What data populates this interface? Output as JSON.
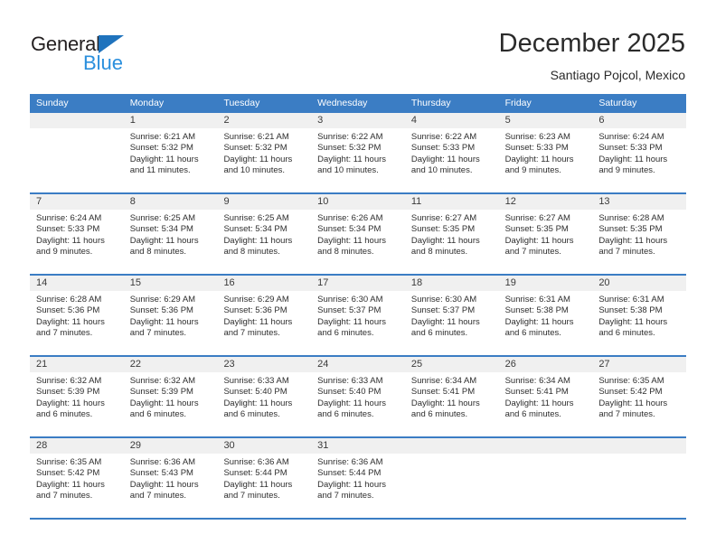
{
  "brand": {
    "name_part1": "General",
    "name_part2": "Blue",
    "triangle_icon": "triangle-icon",
    "primary_color": "#2a8fdd",
    "dark_color": "#231f20"
  },
  "header": {
    "title": "December 2025",
    "subtitle": "Santiago Pojcol, Mexico"
  },
  "calendar": {
    "header_color": "#3b7dc4",
    "weekdays": [
      "Sunday",
      "Monday",
      "Tuesday",
      "Wednesday",
      "Thursday",
      "Friday",
      "Saturday"
    ],
    "weeks": [
      [
        {
          "day": "",
          "sunrise": "",
          "sunset": "",
          "daylight_line1": "",
          "daylight_line2": ""
        },
        {
          "day": "1",
          "sunrise": "Sunrise: 6:21 AM",
          "sunset": "Sunset: 5:32 PM",
          "daylight_line1": "Daylight: 11 hours",
          "daylight_line2": "and 11 minutes."
        },
        {
          "day": "2",
          "sunrise": "Sunrise: 6:21 AM",
          "sunset": "Sunset: 5:32 PM",
          "daylight_line1": "Daylight: 11 hours",
          "daylight_line2": "and 10 minutes."
        },
        {
          "day": "3",
          "sunrise": "Sunrise: 6:22 AM",
          "sunset": "Sunset: 5:32 PM",
          "daylight_line1": "Daylight: 11 hours",
          "daylight_line2": "and 10 minutes."
        },
        {
          "day": "4",
          "sunrise": "Sunrise: 6:22 AM",
          "sunset": "Sunset: 5:33 PM",
          "daylight_line1": "Daylight: 11 hours",
          "daylight_line2": "and 10 minutes."
        },
        {
          "day": "5",
          "sunrise": "Sunrise: 6:23 AM",
          "sunset": "Sunset: 5:33 PM",
          "daylight_line1": "Daylight: 11 hours",
          "daylight_line2": "and 9 minutes."
        },
        {
          "day": "6",
          "sunrise": "Sunrise: 6:24 AM",
          "sunset": "Sunset: 5:33 PM",
          "daylight_line1": "Daylight: 11 hours",
          "daylight_line2": "and 9 minutes."
        }
      ],
      [
        {
          "day": "7",
          "sunrise": "Sunrise: 6:24 AM",
          "sunset": "Sunset: 5:33 PM",
          "daylight_line1": "Daylight: 11 hours",
          "daylight_line2": "and 9 minutes."
        },
        {
          "day": "8",
          "sunrise": "Sunrise: 6:25 AM",
          "sunset": "Sunset: 5:34 PM",
          "daylight_line1": "Daylight: 11 hours",
          "daylight_line2": "and 8 minutes."
        },
        {
          "day": "9",
          "sunrise": "Sunrise: 6:25 AM",
          "sunset": "Sunset: 5:34 PM",
          "daylight_line1": "Daylight: 11 hours",
          "daylight_line2": "and 8 minutes."
        },
        {
          "day": "10",
          "sunrise": "Sunrise: 6:26 AM",
          "sunset": "Sunset: 5:34 PM",
          "daylight_line1": "Daylight: 11 hours",
          "daylight_line2": "and 8 minutes."
        },
        {
          "day": "11",
          "sunrise": "Sunrise: 6:27 AM",
          "sunset": "Sunset: 5:35 PM",
          "daylight_line1": "Daylight: 11 hours",
          "daylight_line2": "and 8 minutes."
        },
        {
          "day": "12",
          "sunrise": "Sunrise: 6:27 AM",
          "sunset": "Sunset: 5:35 PM",
          "daylight_line1": "Daylight: 11 hours",
          "daylight_line2": "and 7 minutes."
        },
        {
          "day": "13",
          "sunrise": "Sunrise: 6:28 AM",
          "sunset": "Sunset: 5:35 PM",
          "daylight_line1": "Daylight: 11 hours",
          "daylight_line2": "and 7 minutes."
        }
      ],
      [
        {
          "day": "14",
          "sunrise": "Sunrise: 6:28 AM",
          "sunset": "Sunset: 5:36 PM",
          "daylight_line1": "Daylight: 11 hours",
          "daylight_line2": "and 7 minutes."
        },
        {
          "day": "15",
          "sunrise": "Sunrise: 6:29 AM",
          "sunset": "Sunset: 5:36 PM",
          "daylight_line1": "Daylight: 11 hours",
          "daylight_line2": "and 7 minutes."
        },
        {
          "day": "16",
          "sunrise": "Sunrise: 6:29 AM",
          "sunset": "Sunset: 5:36 PM",
          "daylight_line1": "Daylight: 11 hours",
          "daylight_line2": "and 7 minutes."
        },
        {
          "day": "17",
          "sunrise": "Sunrise: 6:30 AM",
          "sunset": "Sunset: 5:37 PM",
          "daylight_line1": "Daylight: 11 hours",
          "daylight_line2": "and 6 minutes."
        },
        {
          "day": "18",
          "sunrise": "Sunrise: 6:30 AM",
          "sunset": "Sunset: 5:37 PM",
          "daylight_line1": "Daylight: 11 hours",
          "daylight_line2": "and 6 minutes."
        },
        {
          "day": "19",
          "sunrise": "Sunrise: 6:31 AM",
          "sunset": "Sunset: 5:38 PM",
          "daylight_line1": "Daylight: 11 hours",
          "daylight_line2": "and 6 minutes."
        },
        {
          "day": "20",
          "sunrise": "Sunrise: 6:31 AM",
          "sunset": "Sunset: 5:38 PM",
          "daylight_line1": "Daylight: 11 hours",
          "daylight_line2": "and 6 minutes."
        }
      ],
      [
        {
          "day": "21",
          "sunrise": "Sunrise: 6:32 AM",
          "sunset": "Sunset: 5:39 PM",
          "daylight_line1": "Daylight: 11 hours",
          "daylight_line2": "and 6 minutes."
        },
        {
          "day": "22",
          "sunrise": "Sunrise: 6:32 AM",
          "sunset": "Sunset: 5:39 PM",
          "daylight_line1": "Daylight: 11 hours",
          "daylight_line2": "and 6 minutes."
        },
        {
          "day": "23",
          "sunrise": "Sunrise: 6:33 AM",
          "sunset": "Sunset: 5:40 PM",
          "daylight_line1": "Daylight: 11 hours",
          "daylight_line2": "and 6 minutes."
        },
        {
          "day": "24",
          "sunrise": "Sunrise: 6:33 AM",
          "sunset": "Sunset: 5:40 PM",
          "daylight_line1": "Daylight: 11 hours",
          "daylight_line2": "and 6 minutes."
        },
        {
          "day": "25",
          "sunrise": "Sunrise: 6:34 AM",
          "sunset": "Sunset: 5:41 PM",
          "daylight_line1": "Daylight: 11 hours",
          "daylight_line2": "and 6 minutes."
        },
        {
          "day": "26",
          "sunrise": "Sunrise: 6:34 AM",
          "sunset": "Sunset: 5:41 PM",
          "daylight_line1": "Daylight: 11 hours",
          "daylight_line2": "and 6 minutes."
        },
        {
          "day": "27",
          "sunrise": "Sunrise: 6:35 AM",
          "sunset": "Sunset: 5:42 PM",
          "daylight_line1": "Daylight: 11 hours",
          "daylight_line2": "and 7 minutes."
        }
      ],
      [
        {
          "day": "28",
          "sunrise": "Sunrise: 6:35 AM",
          "sunset": "Sunset: 5:42 PM",
          "daylight_line1": "Daylight: 11 hours",
          "daylight_line2": "and 7 minutes."
        },
        {
          "day": "29",
          "sunrise": "Sunrise: 6:36 AM",
          "sunset": "Sunset: 5:43 PM",
          "daylight_line1": "Daylight: 11 hours",
          "daylight_line2": "and 7 minutes."
        },
        {
          "day": "30",
          "sunrise": "Sunrise: 6:36 AM",
          "sunset": "Sunset: 5:44 PM",
          "daylight_line1": "Daylight: 11 hours",
          "daylight_line2": "and 7 minutes."
        },
        {
          "day": "31",
          "sunrise": "Sunrise: 6:36 AM",
          "sunset": "Sunset: 5:44 PM",
          "daylight_line1": "Daylight: 11 hours",
          "daylight_line2": "and 7 minutes."
        },
        {
          "day": "",
          "sunrise": "",
          "sunset": "",
          "daylight_line1": "",
          "daylight_line2": ""
        },
        {
          "day": "",
          "sunrise": "",
          "sunset": "",
          "daylight_line1": "",
          "daylight_line2": ""
        },
        {
          "day": "",
          "sunrise": "",
          "sunset": "",
          "daylight_line1": "",
          "daylight_line2": ""
        }
      ]
    ]
  }
}
